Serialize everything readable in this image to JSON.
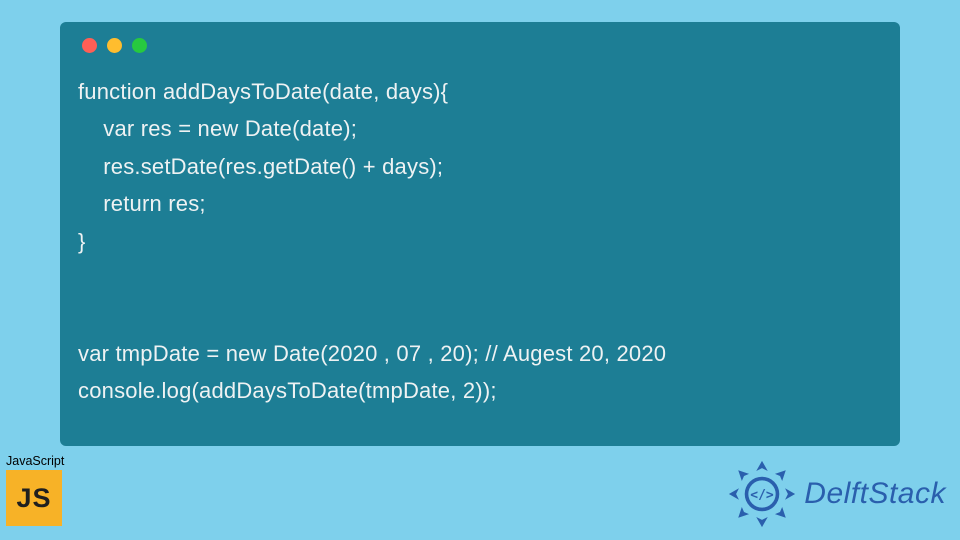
{
  "code": {
    "line1": "function addDaysToDate(date, days){",
    "line2": "    var res = new Date(date);",
    "line3": "    res.setDate(res.getDate() + days);",
    "line4": "    return res;",
    "line5": "}",
    "line6": "",
    "line7": "",
    "line8": "var tmpDate = new Date(2020 , 07 , 20); // Augest 20, 2020",
    "line9": "console.log(addDaysToDate(tmpDate, 2));"
  },
  "badges": {
    "js_label": "JavaScript",
    "js_abbrev": "JS"
  },
  "brand": {
    "name": "DelftStack"
  },
  "colors": {
    "background": "#7ed0ec",
    "window": "#1d7e95",
    "js_bg": "#f7b227",
    "brand_text": "#2a5fad"
  }
}
